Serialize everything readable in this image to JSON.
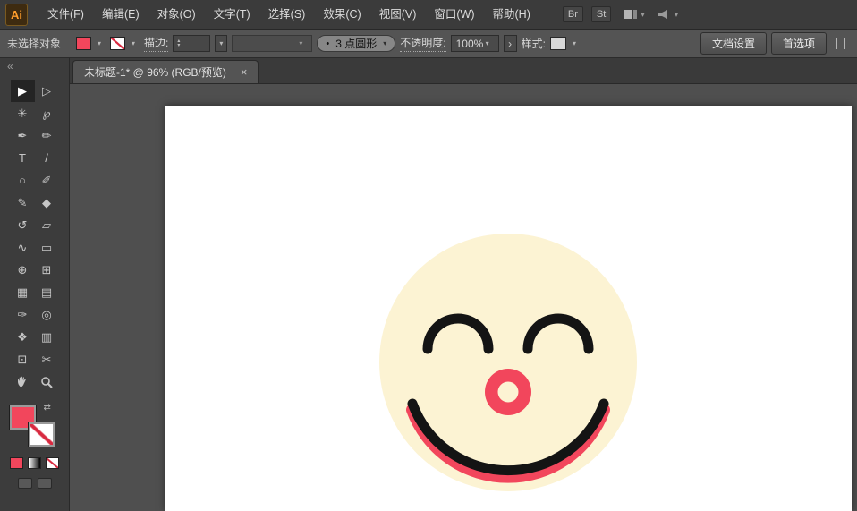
{
  "colors": {
    "accent": "#f2465c",
    "face": "#fcf3d3",
    "feature": "#141414"
  },
  "icons": {
    "caret": "▾",
    "spin_up": "▴",
    "spin_down": "▾",
    "chevron": "›",
    "collapse": "«",
    "swap": "⇄",
    "bullet": "•",
    "close": "×"
  },
  "menubar": {
    "logo": "Ai",
    "items": [
      "文件(F)",
      "编辑(E)",
      "对象(O)",
      "文字(T)",
      "选择(S)",
      "效果(C)",
      "视图(V)",
      "窗口(W)",
      "帮助(H)"
    ],
    "bridge_badge": "Br",
    "stock_badge": "St"
  },
  "controlbar": {
    "status": "未选择对象",
    "stroke_label": "描边:",
    "stroke_value": "",
    "brush_value": "3 点圆形",
    "opacity_label": "不透明度:",
    "opacity_value": "100%",
    "style_label": "样式:",
    "document_setup": "文档设置",
    "preferences": "首选项"
  },
  "tabbar": {
    "title": "未标题-1* @ 96% (RGB/预览)"
  },
  "toolbar": {
    "tools": [
      {
        "name": "selection",
        "glyph": "▶"
      },
      {
        "name": "direct-selection",
        "glyph": "▷"
      },
      {
        "name": "magic-wand",
        "glyph": "✳"
      },
      {
        "name": "lasso",
        "glyph": "℘"
      },
      {
        "name": "pen",
        "glyph": "✒"
      },
      {
        "name": "add-anchor-point",
        "glyph": "✏"
      },
      {
        "name": "type",
        "glyph": "T"
      },
      {
        "name": "line-segment",
        "glyph": "/"
      },
      {
        "name": "ellipse",
        "glyph": "○"
      },
      {
        "name": "paintbrush",
        "glyph": "✐"
      },
      {
        "name": "pencil",
        "glyph": "✎"
      },
      {
        "name": "eraser",
        "glyph": "◆"
      },
      {
        "name": "rotate",
        "glyph": "↺"
      },
      {
        "name": "scale",
        "glyph": "▱"
      },
      {
        "name": "width",
        "glyph": "∿"
      },
      {
        "name": "free-transform",
        "glyph": "▭"
      },
      {
        "name": "shape-builder",
        "glyph": "⊕"
      },
      {
        "name": "perspective-grid",
        "glyph": "⊞"
      },
      {
        "name": "mesh",
        "glyph": "▦"
      },
      {
        "name": "gradient",
        "glyph": "▤"
      },
      {
        "name": "eyedropper",
        "glyph": "✑"
      },
      {
        "name": "blend",
        "glyph": "◎"
      },
      {
        "name": "symbol-sprayer",
        "glyph": "❖"
      },
      {
        "name": "column-graph",
        "glyph": "▥"
      },
      {
        "name": "artboard",
        "glyph": "⊡"
      },
      {
        "name": "slice",
        "glyph": "✂"
      },
      {
        "name": "hand",
        "glyph": ""
      },
      {
        "name": "zoom",
        "glyph": ""
      }
    ]
  }
}
